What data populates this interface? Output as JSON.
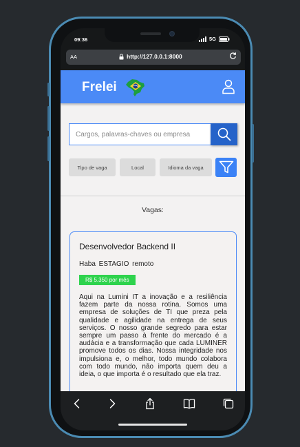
{
  "status": {
    "time": "09:36",
    "network": "5G"
  },
  "browser": {
    "aa_label": "AA",
    "url": "http://127.0.0.1:8000"
  },
  "header": {
    "logo": "Frelei"
  },
  "search": {
    "placeholder": "Cargos, palavras-chaves ou empresa"
  },
  "filters": [
    {
      "label": "Tipo de vaga"
    },
    {
      "label": "Local"
    },
    {
      "label": "Idioma da vaga"
    }
  ],
  "listing": {
    "title": "Vagas:"
  },
  "job": {
    "title": "Desenvolvedor Backend II",
    "meta": "Haba  ESTAGIO  remoto",
    "salary": "R$ 5.350 por mês",
    "description": "Aqui na Lumini IT a inovação e a resiliência fazem parte da nossa rotina. Somos uma empresa de soluções de TI que preza pela qualidade e agilidade na entrega de seus serviços. O nosso grande segredo para estar sempre um passo à frente do mercado é a audácia e a transformação que cada LUMINER promove todos os dias. Nossa integridade nos impulsiona e, o melhor, todo mundo colabora com todo mundo, não importa quem deu a ideia, o que importa é o resultado que ela traz."
  },
  "colors": {
    "header": "#4b8af6",
    "search_button": "#2563c9",
    "salary_badge": "#2ed34d",
    "filter_button": "#3b82f6"
  }
}
